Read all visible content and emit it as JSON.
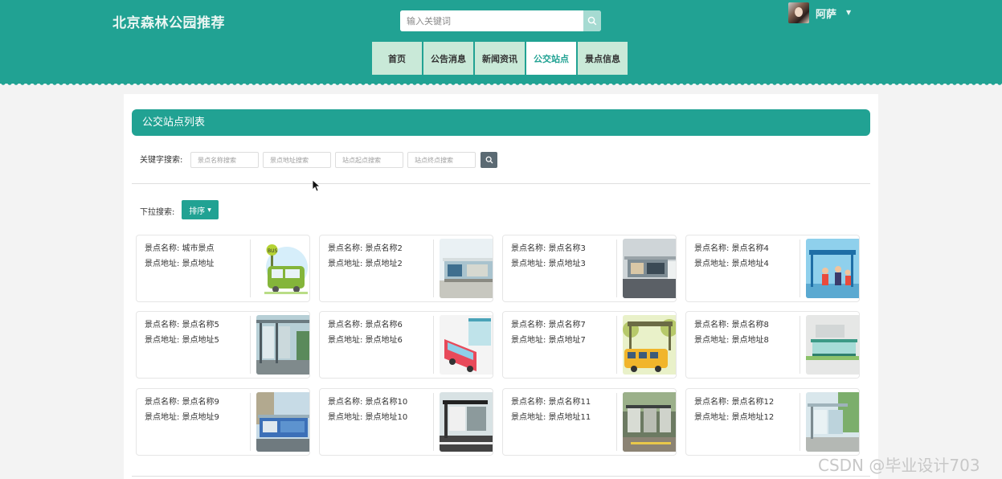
{
  "header": {
    "site_title": "北京森林公园推荐",
    "search_placeholder": "输入关键词",
    "username": "阿萨"
  },
  "nav": [
    {
      "label": "首页",
      "active": false
    },
    {
      "label": "公告消息",
      "active": false
    },
    {
      "label": "新闻资讯",
      "active": false
    },
    {
      "label": "公交站点",
      "active": true
    },
    {
      "label": "景点信息",
      "active": false
    }
  ],
  "main": {
    "list_title": "公交站点列表",
    "keyword_label": "关键字搜索:",
    "search_fields": [
      {
        "placeholder": "景点名称搜索"
      },
      {
        "placeholder": "景点地址搜索"
      },
      {
        "placeholder": "站点起点搜索"
      },
      {
        "placeholder": "站点终点搜索"
      }
    ],
    "dropdown_label": "下拉搜索:",
    "sort_label": "排序",
    "items": [
      {
        "name": "景点名称: 城市景点",
        "address": "景点地址: 景点地址"
      },
      {
        "name": "景点名称: 景点名称2",
        "address": "景点地址: 景点地址2"
      },
      {
        "name": "景点名称: 景点名称3",
        "address": "景点地址: 景点地址3"
      },
      {
        "name": "景点名称: 景点名称4",
        "address": "景点地址: 景点地址4"
      },
      {
        "name": "景点名称: 景点名称5",
        "address": "景点地址: 景点地址5"
      },
      {
        "name": "景点名称: 景点名称6",
        "address": "景点地址: 景点地址6"
      },
      {
        "name": "景点名称: 景点名称7",
        "address": "景点地址: 景点地址7"
      },
      {
        "name": "景点名称: 景点名称8",
        "address": "景点地址: 景点地址8"
      },
      {
        "name": "景点名称: 景点名称9",
        "address": "景点地址: 景点地址9"
      },
      {
        "name": "景点名称: 景点名称10",
        "address": "景点地址: 景点地址10"
      },
      {
        "name": "景点名称: 景点名称11",
        "address": "景点地址: 景点地址11"
      },
      {
        "name": "景点名称: 景点名称12",
        "address": "景点地址: 景点地址12"
      }
    ]
  },
  "watermark": "CSDN @毕业设计703",
  "colors": {
    "primary": "#21a293",
    "nav_bg": "#c9e9d8",
    "search_btn": "#5b6a73"
  },
  "icons": {
    "search": "search-icon",
    "caret": "caret-down-icon"
  }
}
